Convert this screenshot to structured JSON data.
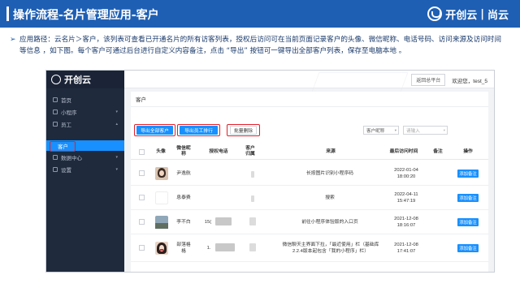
{
  "slide": {
    "title": "操作流程-名片管理应用-客户",
    "brand_name": "开创云",
    "brand_sep": "|",
    "brand_suffix": "尚云",
    "bullet": "➢",
    "description": "应用路径：云名片＞客户，该列表可查看已开通名片的所有访客列表，授权后访问可在当前页面记录客户的头像、微信昵称、电话号码、访问来源及访问时间等信息 ，如下图。每个客户可通过后台进行自定义内容备注，点击 “导出” 按钮可一键导出全部客户列表，保存至电脑本地 。"
  },
  "app": {
    "logo_text": "开创云",
    "topbar": {
      "back_button": "返回总平台",
      "welcome": "欢迎您，test_5"
    },
    "sidebar": [
      {
        "label": "首页",
        "caret": ""
      },
      {
        "label": "小程序",
        "caret": "▾"
      },
      {
        "label": "员工",
        "caret": "▴"
      },
      {
        "label": "客户",
        "caret": "",
        "active": true
      },
      {
        "label": "数据中心",
        "caret": "▾"
      },
      {
        "label": "设置",
        "caret": "▾"
      }
    ],
    "breadcrumb": "客户",
    "actions": {
      "export_all": "导出全部客户",
      "export_staff": "导出员工排行",
      "batch_delete": "批量删除"
    },
    "filter": {
      "select_value": "客户昵称",
      "select_caret": "▾",
      "input_placeholder": "请输入",
      "input_caret": "▾"
    },
    "table": {
      "headers": {
        "avatar": "头像",
        "nickname": "微信昵称",
        "phone": "授权电话",
        "owner": "客户归属",
        "source": "来源",
        "last_visit": "最后访问时间",
        "remark": "备注",
        "action": "操作"
      },
      "rows": [
        {
          "nickname": "尹逸航",
          "phone": "",
          "source": "长按图片识别小程序码",
          "time_date": "2022-01-04",
          "time_clock": "18:00:20",
          "action": "添加备注"
        },
        {
          "nickname": "息泰费",
          "phone": "",
          "source": "搜索",
          "time_date": "2022-04-11",
          "time_clock": "15:47:19",
          "action": "添加备注"
        },
        {
          "nickname": "李不白",
          "phone": "15(",
          "source": "前往小程序体验版的入口页",
          "time_date": "2021-12-08",
          "time_clock": "18:16:07",
          "action": "添加备注"
        },
        {
          "nickname": "部落格格",
          "phone": "1.",
          "source": "微信聊天主界面下拉，「最近使用」栏（基础库2.2.4版本起包含「我的小程序」栏）",
          "time_date": "2021-12-08",
          "time_clock": "17:41:07",
          "action": "添加备注"
        }
      ]
    }
  },
  "colors": {
    "header_blue": "#1e5fb4",
    "sidebar_dark": "#1f2a3d",
    "primary_button": "#1890ff",
    "highlight_red": "#e0202a"
  }
}
